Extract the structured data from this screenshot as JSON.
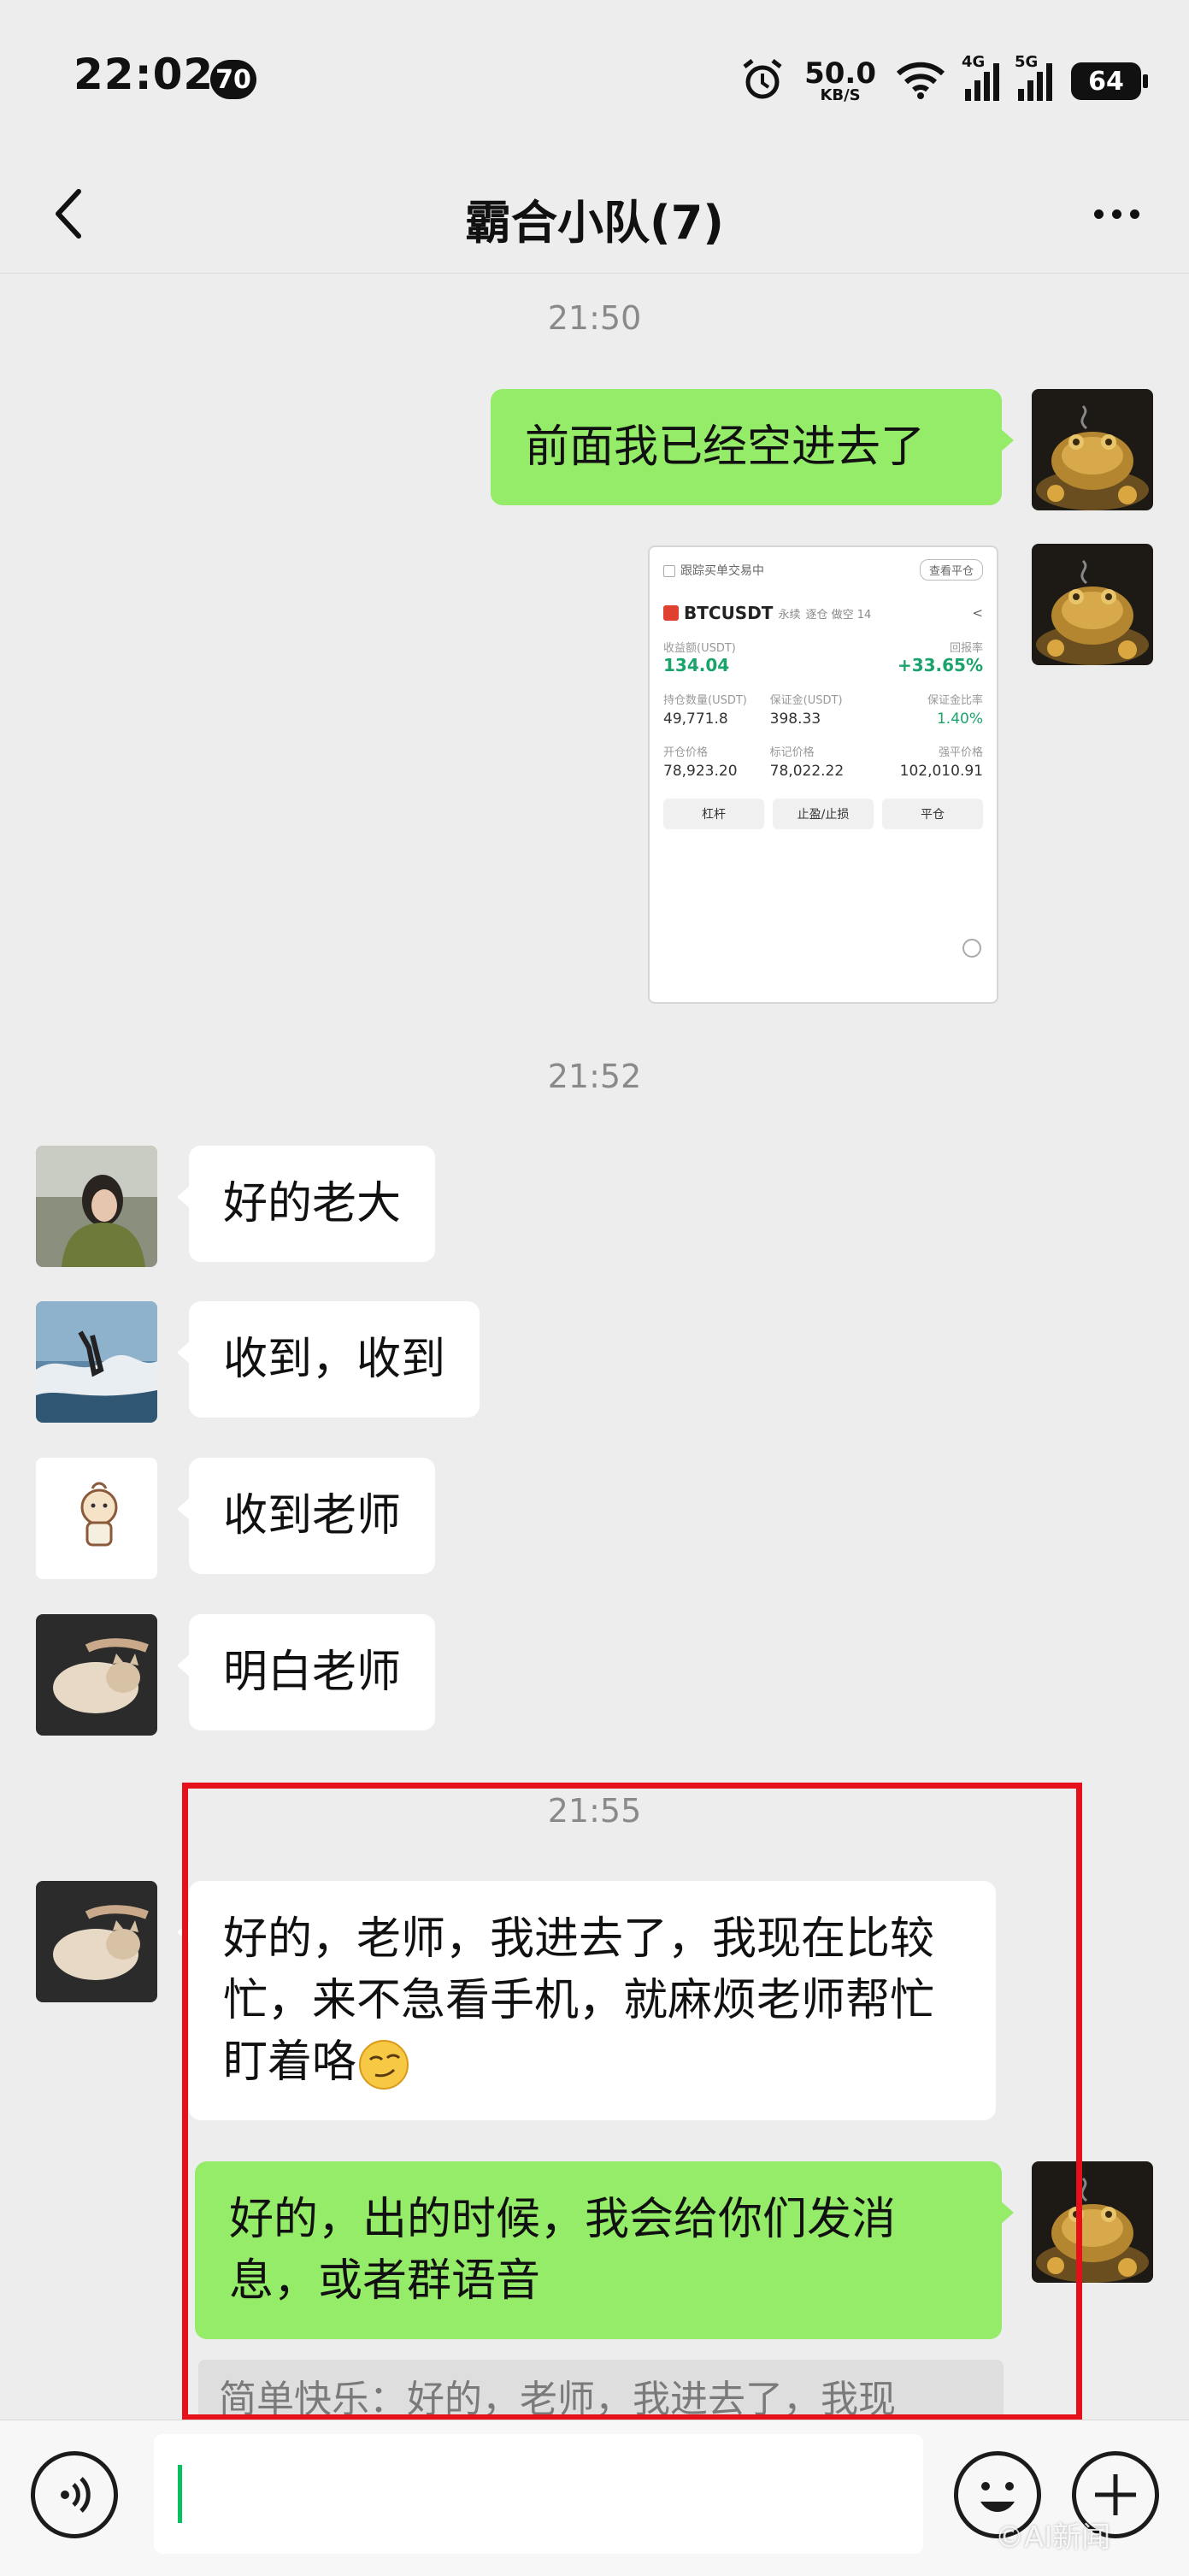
{
  "status_bar": {
    "time": "22:02",
    "notification_count": "70",
    "net_speed_value": "50.0",
    "net_speed_unit": "KB/S",
    "signal_1_label": "4G",
    "signal_2_label": "5G",
    "battery_level": "64"
  },
  "header": {
    "title": "霸合小队(7)"
  },
  "chat": {
    "time_1": "21:50",
    "msg_1": "前面我已经空进去了",
    "screenshot": {
      "header_label": "跟踪买单交易中",
      "header_action": "查看平仓",
      "symbol": "BTCUSDT",
      "symbol_tag": "永续",
      "symbol_extra": "逐仓 做空 14",
      "pnl_label": "收益额(USDT)",
      "pnl_value": "134.04",
      "roe_label": "回报率",
      "roe_value": "+33.65%",
      "r1c1_label": "持仓数量(USDT)",
      "r1c1_value": "49,771.8",
      "r1c2_label": "保证金(USDT)",
      "r1c2_value": "398.33",
      "r1c3_label": "保证金比率",
      "r1c3_value": "1.40%",
      "r2c1_label": "开仓价格",
      "r2c1_value": "78,923.20",
      "r2c2_label": "标记价格",
      "r2c2_value": "78,022.22",
      "r2c3_label": "强平价格",
      "r2c3_value": "102,010.91",
      "btn_1": "杠杆",
      "btn_2": "止盈/止损",
      "btn_3": "平仓"
    },
    "time_2": "21:52",
    "msg_2": "好的老大",
    "msg_3": "收到，收到",
    "msg_4": "收到老师",
    "msg_5": "明白老师",
    "time_3": "21:55",
    "msg_6": "好的，老师，我进去了，我现在比较忙，来不急看手机，就麻烦老师帮忙盯着咯",
    "msg_7": "好的，出的时候，我会给你们发消息，或者群语音",
    "quote": "简单快乐：好的，老师，我进去了，我现"
  },
  "input": {
    "value": ""
  },
  "watermark": "©AI新闻"
}
